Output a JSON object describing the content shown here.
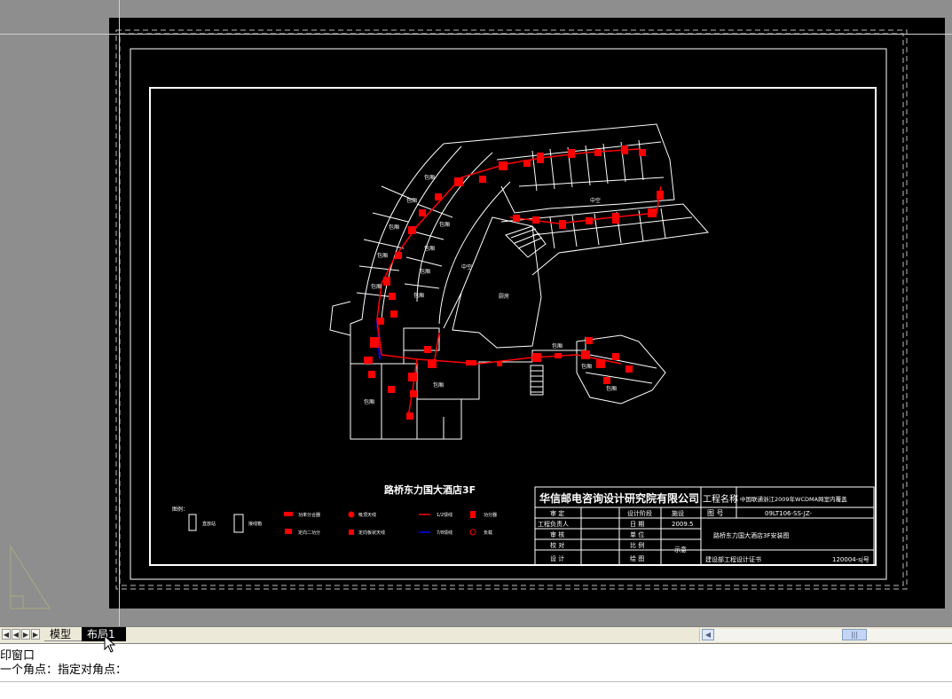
{
  "tabs": {
    "model": "模型",
    "layout1": "布局1"
  },
  "command": {
    "line1": "印窗口",
    "line2": "一个角点：指定对角点："
  },
  "drawing": {
    "plan_title": "路桥东力国大酒店3F",
    "legend_title": "图例：",
    "legend": [
      {
        "label": "直放站"
      },
      {
        "label": "接线箱"
      },
      {
        "label": "功率分合器"
      },
      {
        "label": "吸顶天线"
      },
      {
        "label": "1/2馈线"
      },
      {
        "label": "功分器"
      },
      {
        "label": "定向二功分"
      },
      {
        "label": "定向板状天线"
      },
      {
        "label": "7/8馈线"
      },
      {
        "label": "负载"
      }
    ],
    "room_labels": [
      {
        "text": "包厢"
      },
      {
        "text": "中空"
      },
      {
        "text": "厨房"
      }
    ],
    "title_block": {
      "company": "华信邮电咨询设计研究院有限公司",
      "project_name_label": "工程名称",
      "project_name": "中国联通浙江2009年WCDMA网室内覆盖",
      "review_label": "审 定",
      "design_stage_label": "设计阶段",
      "design_stage": "施设",
      "drawing_no_label": "图 号",
      "drawing_no": "09LT106-SS-JZ-",
      "leader_label": "工程负责人",
      "date_label": "日 期",
      "date": "2009.5",
      "audit_label": "审 核",
      "unit_label": "单 位",
      "check_label": "校 对",
      "scale_label": "比 例",
      "scale": "示意",
      "design_label": "设 计",
      "draw_label": "绘 图",
      "drawing_title": "路桥东力国大酒店3F安装图",
      "cert_label": "建设部工程设计证书",
      "cert_no": "120004-sj号"
    }
  },
  "colors": {
    "background": "#000000",
    "linework": "#ffffff",
    "equipment": "#ff0000",
    "feeder_78": "#0000ff",
    "workspace": "#8e8e8e"
  }
}
